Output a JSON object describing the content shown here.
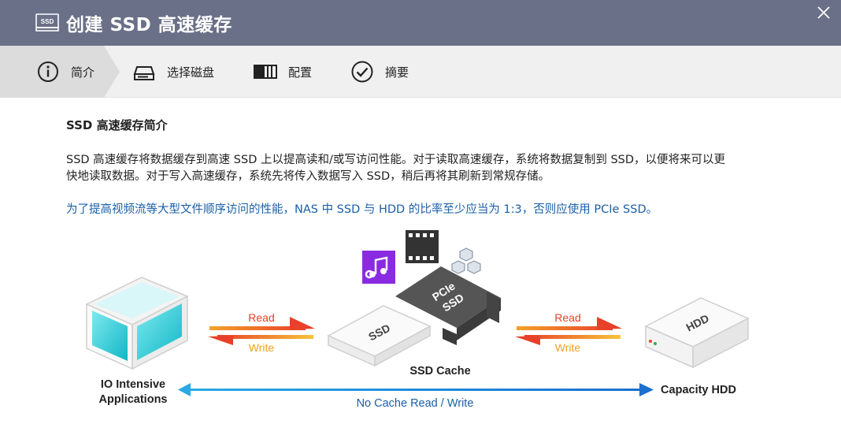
{
  "window": {
    "title": "创建 SSD 高速缓存",
    "title_icon": "ssd-icon",
    "close_icon": "close-icon"
  },
  "wizard": {
    "steps": [
      {
        "label": "简介",
        "icon": "info-icon",
        "active": true
      },
      {
        "label": "选择磁盘",
        "icon": "disk-icon",
        "active": false
      },
      {
        "label": "配置",
        "icon": "config-icon",
        "active": false
      },
      {
        "label": "摘要",
        "icon": "check-circle-icon",
        "active": false
      }
    ]
  },
  "main": {
    "heading": "SSD 高速缓存简介",
    "description_line1": "SSD 高速缓存将数据缓存到高速 SSD 上以提高读和/或写访问性能。对于读取高速缓存，系统将数据复制到 SSD，以便将来可以更",
    "description_line2": "快地读取数据。对于写入高速缓存，系统先将传入数据写入 SSD，稍后再将其刷新到常规存储。",
    "note": "为了提高视频流等大型文件顺序访问的性能，NAS 中 SSD 与 HDD 的比率至少应当为 1:3，否则应使用 PCIe SSD。"
  },
  "diagram": {
    "io_label_line1": "IO Intensive",
    "io_label_line2": "Applications",
    "read_label_1": "Read",
    "write_label_1": "Write",
    "ssd_text": "SSD",
    "pcie_text_1": "PCIe",
    "pcie_text_2": "SSD",
    "ssd_cache_label": "SSD Cache",
    "read_label_2": "Read",
    "write_label_2": "Write",
    "hdd_text": "HDD",
    "capacity_label": "Capacity HDD",
    "no_cache_label": "No Cache Read / Write",
    "colors": {
      "titlebar": "#6a7087",
      "note_text": "#1a5fa8",
      "read_arrow": "#e8402a",
      "write_arrow": "#f1a21c",
      "bypass_arrow": "#1e8fd8",
      "music_box": "#8a2be2"
    }
  }
}
